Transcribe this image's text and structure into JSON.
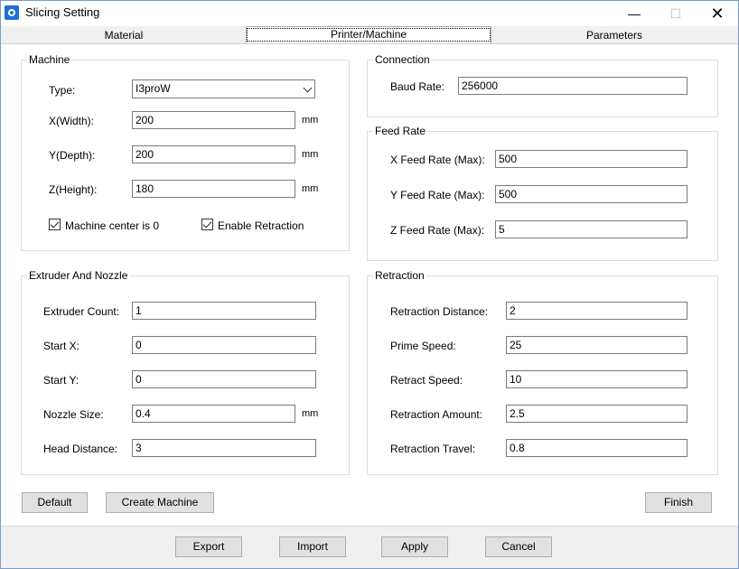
{
  "window": {
    "title": "Slicing Setting",
    "minimize_glyph": "—",
    "maximize_glyph": "☐",
    "close_glyph": "✕"
  },
  "tabs": [
    {
      "label": "Material"
    },
    {
      "label": "Printer/Machine"
    },
    {
      "label": "Parameters"
    }
  ],
  "machine": {
    "title": "Machine",
    "type_label": "Type:",
    "type_value": "I3proW",
    "x_label": "X(Width):",
    "x_value": "200",
    "y_label": "Y(Depth):",
    "y_value": "200",
    "z_label": "Z(Height):",
    "z_value": "180",
    "unit": "mm",
    "center_label": "Machine center is 0",
    "retraction_label": "Enable Retraction"
  },
  "connection": {
    "title": "Connection",
    "baud_label": "Baud Rate:",
    "baud_value": "256000"
  },
  "feed_rate": {
    "title": "Feed Rate",
    "x_label": "X Feed Rate (Max):",
    "x_value": "500",
    "y_label": "Y Feed Rate (Max):",
    "y_value": "500",
    "z_label": "Z Feed Rate (Max):",
    "z_value": "5"
  },
  "extruder": {
    "title": "Extruder And Nozzle",
    "count_label": "Extruder Count:",
    "count_value": "1",
    "start_x_label": "Start X:",
    "start_x_value": "0",
    "start_y_label": "Start Y:",
    "start_y_value": "0",
    "nozzle_label": "Nozzle Size:",
    "nozzle_value": "0.4",
    "nozzle_unit": "mm",
    "head_label": "Head Distance:",
    "head_value": "3"
  },
  "retraction": {
    "title": "Retraction",
    "distance_label": "Retraction Distance:",
    "distance_value": "2",
    "prime_label": "Prime Speed:",
    "prime_value": "25",
    "retract_label": "Retract Speed:",
    "retract_value": "10",
    "amount_label": "Retraction Amount:",
    "amount_value": "2.5",
    "travel_label": "Retraction Travel:",
    "travel_value": "0.8"
  },
  "buttons": {
    "default": "Default",
    "create_machine": "Create Machine",
    "finish": "Finish",
    "export": "Export",
    "import": "Import",
    "apply": "Apply",
    "cancel": "Cancel"
  }
}
